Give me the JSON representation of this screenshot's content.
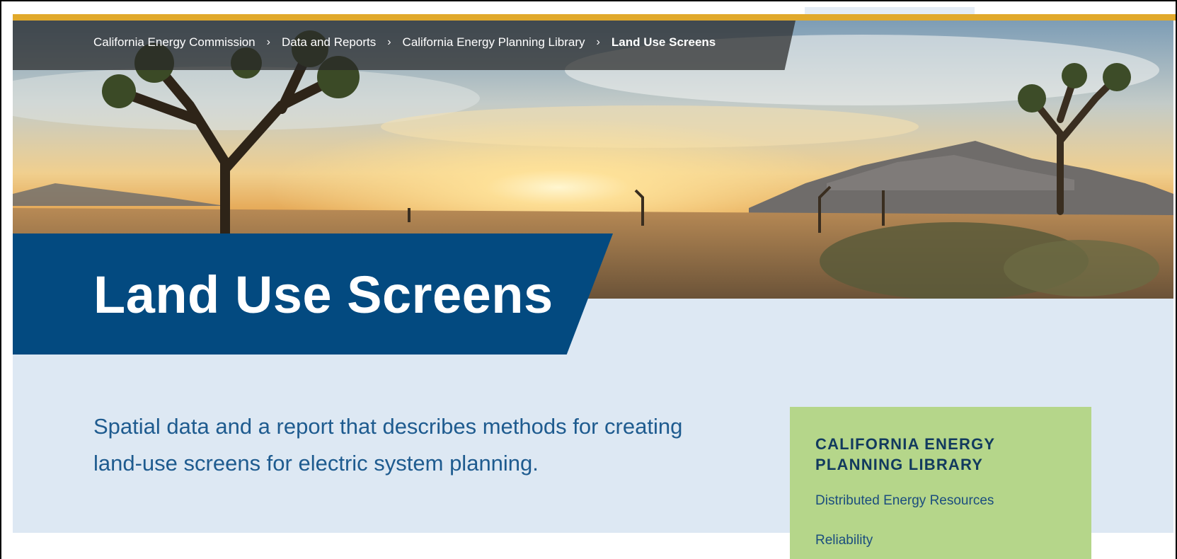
{
  "breadcrumb": {
    "items": [
      {
        "label": "California Energy Commission"
      },
      {
        "label": "Data and Reports"
      },
      {
        "label": "California Energy Planning Library"
      }
    ],
    "current": "Land Use Screens",
    "separator_glyph": "›"
  },
  "hero": {
    "title": "Land Use Screens"
  },
  "intro": {
    "text": "Spatial data and a report that describes methods for creating land-use screens for electric system planning."
  },
  "sidebar": {
    "heading": "CALIFORNIA ENERGY PLANNING LIBRARY",
    "links": [
      {
        "label": "Distributed Energy Resources"
      },
      {
        "label": "Reliability"
      }
    ]
  },
  "colors": {
    "accent_gold": "#e1a92b",
    "title_panel": "#034a80",
    "content_band": "#dde8f3",
    "sidebar_card": "#b5d68a",
    "intro_text": "#1e5b8f"
  }
}
